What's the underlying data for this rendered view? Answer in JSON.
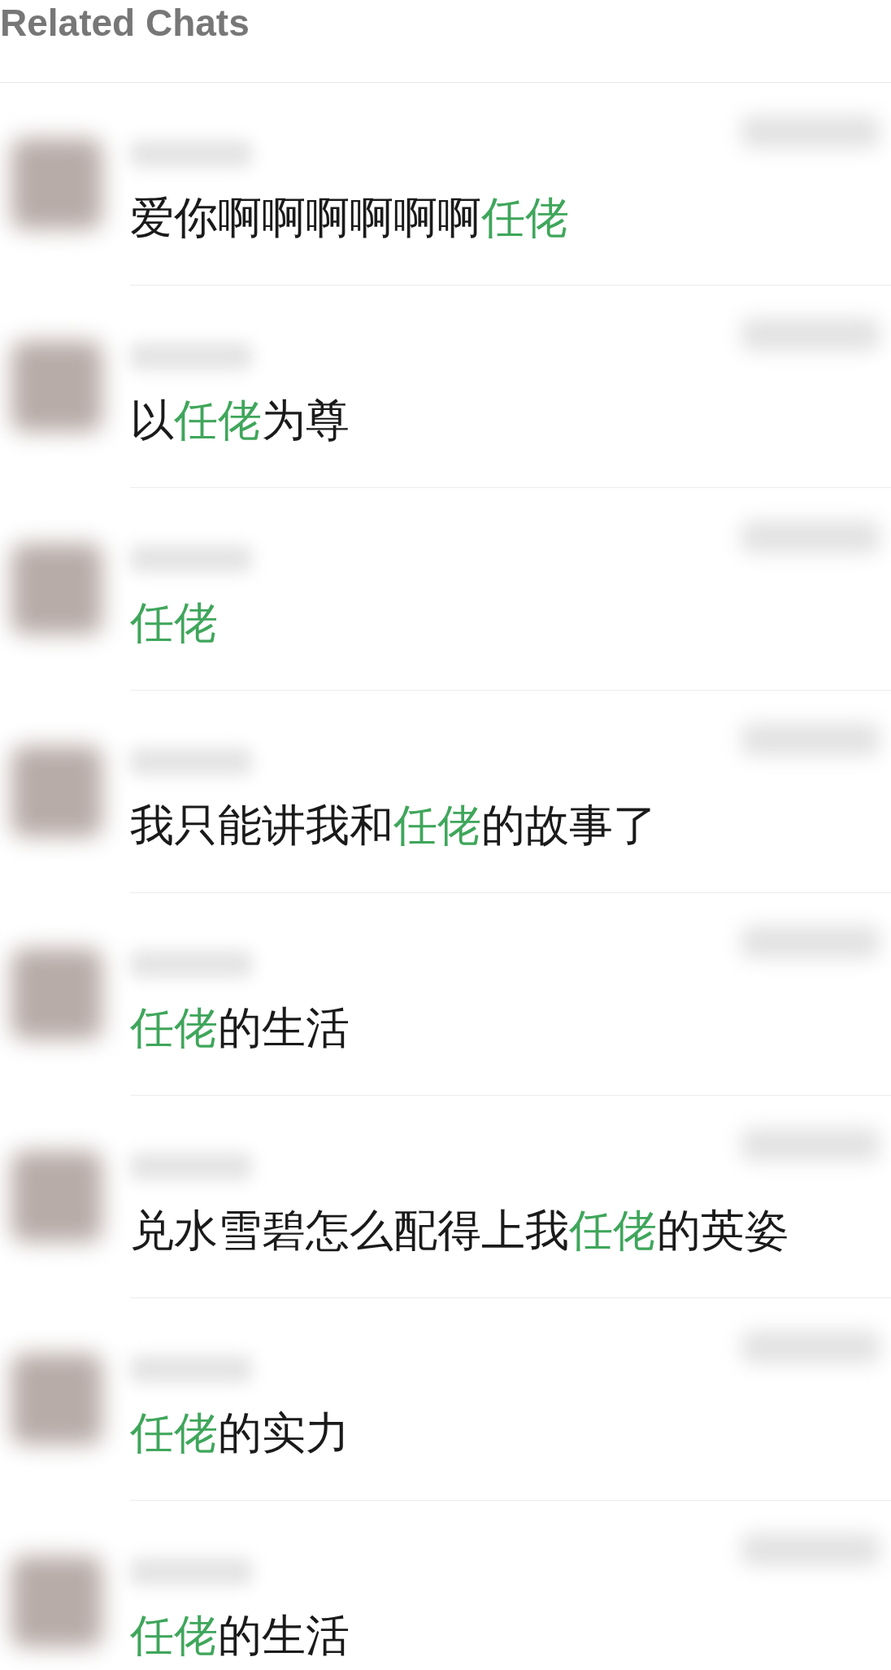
{
  "section": {
    "title": "Related Chats"
  },
  "results": [
    {
      "parts": [
        {
          "text": "爱你啊啊啊啊啊啊",
          "highlight": false
        },
        {
          "text": "任佬",
          "highlight": true
        }
      ]
    },
    {
      "parts": [
        {
          "text": "以",
          "highlight": false
        },
        {
          "text": "任佬",
          "highlight": true
        },
        {
          "text": "为尊",
          "highlight": false
        }
      ]
    },
    {
      "parts": [
        {
          "text": "任佬",
          "highlight": true
        }
      ]
    },
    {
      "parts": [
        {
          "text": "我只能讲我和",
          "highlight": false
        },
        {
          "text": "任佬",
          "highlight": true
        },
        {
          "text": "的故事了",
          "highlight": false
        }
      ]
    },
    {
      "parts": [
        {
          "text": "任佬",
          "highlight": true
        },
        {
          "text": "的生活",
          "highlight": false
        }
      ]
    },
    {
      "parts": [
        {
          "text": "兑水雪碧怎么配得上我",
          "highlight": false
        },
        {
          "text": "任佬",
          "highlight": true
        },
        {
          "text": "的英姿",
          "highlight": false
        }
      ]
    },
    {
      "parts": [
        {
          "text": "任佬",
          "highlight": true
        },
        {
          "text": "的实力",
          "highlight": false
        }
      ]
    },
    {
      "parts": [
        {
          "text": "任佬",
          "highlight": true
        },
        {
          "text": "的生活",
          "highlight": false
        }
      ]
    }
  ]
}
